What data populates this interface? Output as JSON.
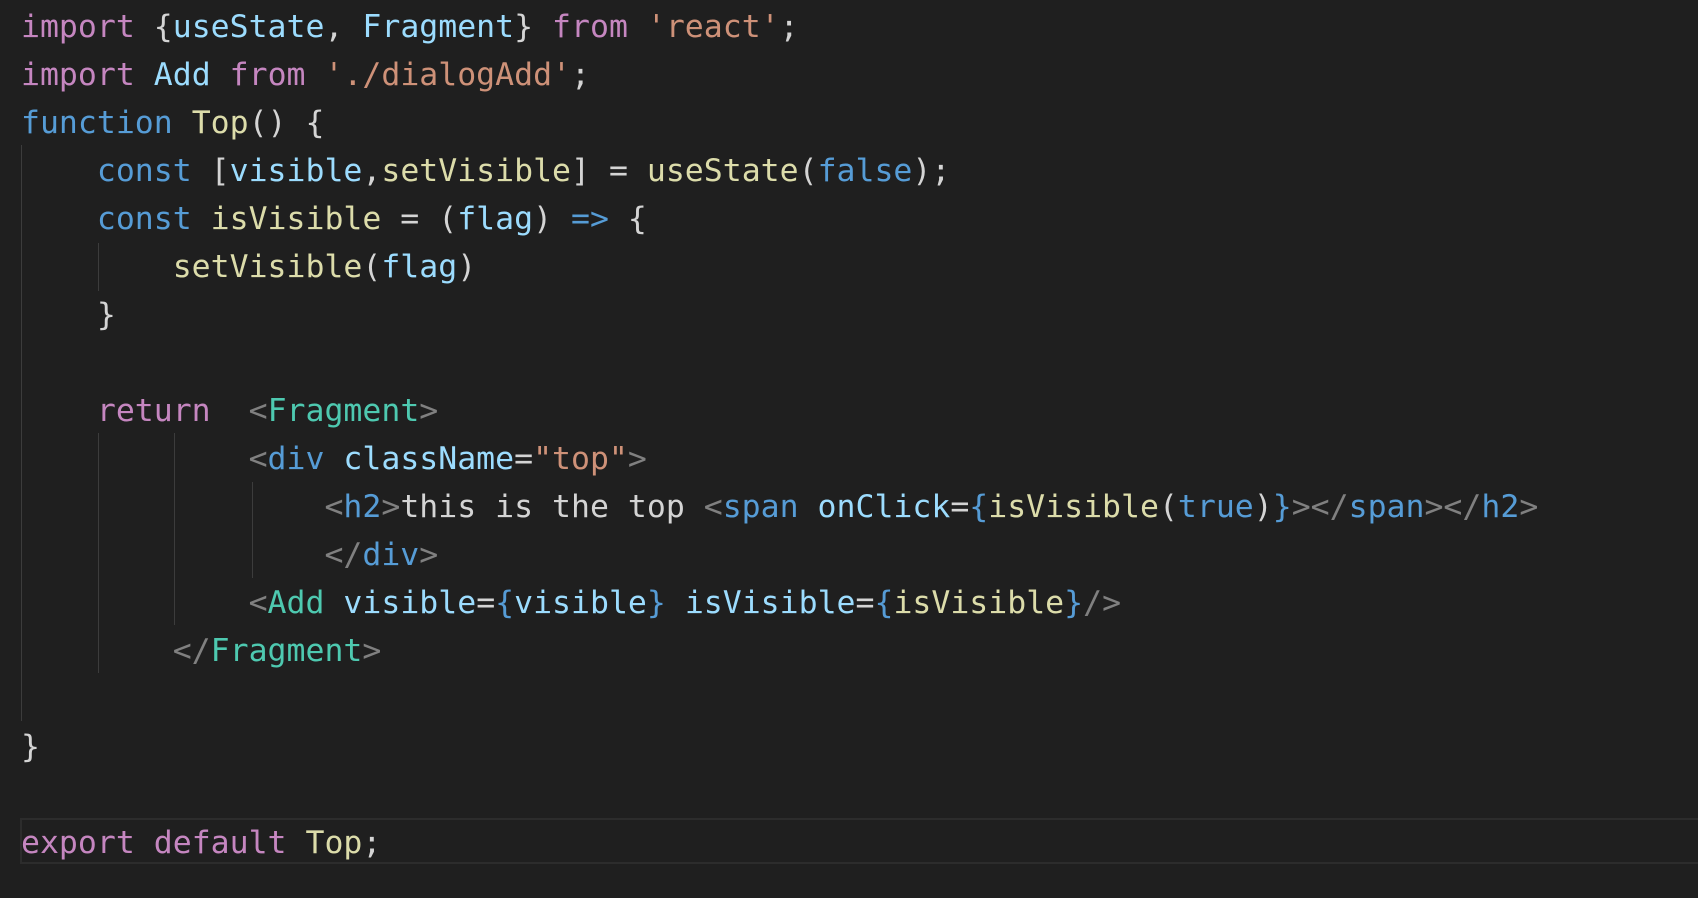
{
  "editor": {
    "language": "JavaScript (JSX)",
    "theme_background": "#1f1f1f",
    "colors": {
      "keyword": "#c586c0",
      "storage": "#569cd6",
      "string": "#ce9178",
      "function": "#dcdcaa",
      "variable": "#9cdcfe",
      "component": "#4ec9b0",
      "punctuation": "#d4d4d4",
      "tag_bracket": "#808080"
    },
    "lines": [
      {
        "tokens": [
          {
            "t": "import",
            "c": "kw"
          },
          {
            "t": " {",
            "c": "pn"
          },
          {
            "t": "useState",
            "c": "var"
          },
          {
            "t": ", ",
            "c": "pn"
          },
          {
            "t": "Fragment",
            "c": "var"
          },
          {
            "t": "} ",
            "c": "pn"
          },
          {
            "t": "from",
            "c": "kw"
          },
          {
            "t": " ",
            "c": "pn"
          },
          {
            "t": "'react'",
            "c": "st"
          },
          {
            "t": ";",
            "c": "pn"
          }
        ]
      },
      {
        "tokens": [
          {
            "t": "import",
            "c": "kw"
          },
          {
            "t": " ",
            "c": "pn"
          },
          {
            "t": "Add",
            "c": "var"
          },
          {
            "t": " ",
            "c": "pn"
          },
          {
            "t": "from",
            "c": "kw"
          },
          {
            "t": " ",
            "c": "pn"
          },
          {
            "t": "'./dialogAdd'",
            "c": "st"
          },
          {
            "t": ";",
            "c": "pn"
          }
        ]
      },
      {
        "tokens": [
          {
            "t": "function",
            "c": "sto"
          },
          {
            "t": " ",
            "c": "pn"
          },
          {
            "t": "Top",
            "c": "fn"
          },
          {
            "t": "() {",
            "c": "pn"
          }
        ]
      },
      {
        "tokens": [
          {
            "t": "    ",
            "c": "pn"
          },
          {
            "t": "const",
            "c": "sto"
          },
          {
            "t": " [",
            "c": "pn"
          },
          {
            "t": "visible",
            "c": "var"
          },
          {
            "t": ",",
            "c": "pn"
          },
          {
            "t": "setVisible",
            "c": "fn"
          },
          {
            "t": "] = ",
            "c": "pn"
          },
          {
            "t": "useState",
            "c": "fn"
          },
          {
            "t": "(",
            "c": "pn"
          },
          {
            "t": "false",
            "c": "sto"
          },
          {
            "t": ");",
            "c": "pn"
          }
        ]
      },
      {
        "tokens": [
          {
            "t": "    ",
            "c": "pn"
          },
          {
            "t": "const",
            "c": "sto"
          },
          {
            "t": " ",
            "c": "pn"
          },
          {
            "t": "isVisible",
            "c": "fn"
          },
          {
            "t": " = (",
            "c": "pn"
          },
          {
            "t": "flag",
            "c": "var"
          },
          {
            "t": ") ",
            "c": "pn"
          },
          {
            "t": "=>",
            "c": "sto"
          },
          {
            "t": " {",
            "c": "pn"
          }
        ]
      },
      {
        "tokens": [
          {
            "t": "        ",
            "c": "pn"
          },
          {
            "t": "setVisible",
            "c": "fn"
          },
          {
            "t": "(",
            "c": "pn"
          },
          {
            "t": "flag",
            "c": "var"
          },
          {
            "t": ")",
            "c": "pn"
          }
        ]
      },
      {
        "tokens": [
          {
            "t": "    }",
            "c": "pn"
          }
        ]
      },
      {
        "tokens": []
      },
      {
        "tokens": [
          {
            "t": "    ",
            "c": "pn"
          },
          {
            "t": "return",
            "c": "kw"
          },
          {
            "t": "  ",
            "c": "pn"
          },
          {
            "t": "<",
            "c": "tagb"
          },
          {
            "t": "Fragment",
            "c": "jsx"
          },
          {
            "t": ">",
            "c": "tagb"
          }
        ]
      },
      {
        "tokens": [
          {
            "t": "            ",
            "c": "pn"
          },
          {
            "t": "<",
            "c": "tagb"
          },
          {
            "t": "div",
            "c": "sto"
          },
          {
            "t": " ",
            "c": "pn"
          },
          {
            "t": "className",
            "c": "var"
          },
          {
            "t": "=",
            "c": "pn"
          },
          {
            "t": "\"top\"",
            "c": "st"
          },
          {
            "t": ">",
            "c": "tagb"
          }
        ]
      },
      {
        "tokens": [
          {
            "t": "                ",
            "c": "pn"
          },
          {
            "t": "<",
            "c": "tagb"
          },
          {
            "t": "h2",
            "c": "sto"
          },
          {
            "t": ">",
            "c": "tagb"
          },
          {
            "t": "this is the top ",
            "c": "txt"
          },
          {
            "t": "<",
            "c": "tagb"
          },
          {
            "t": "span",
            "c": "sto"
          },
          {
            "t": " ",
            "c": "pn"
          },
          {
            "t": "onClick",
            "c": "var"
          },
          {
            "t": "=",
            "c": "pn"
          },
          {
            "t": "{",
            "c": "sto"
          },
          {
            "t": "isVisible",
            "c": "fn"
          },
          {
            "t": "(",
            "c": "pn"
          },
          {
            "t": "true",
            "c": "sto"
          },
          {
            "t": ")",
            "c": "pn"
          },
          {
            "t": "}",
            "c": "sto"
          },
          {
            "t": "></",
            "c": "tagb"
          },
          {
            "t": "span",
            "c": "sto"
          },
          {
            "t": "></",
            "c": "tagb"
          },
          {
            "t": "h2",
            "c": "sto"
          },
          {
            "t": ">",
            "c": "tagb"
          }
        ]
      },
      {
        "tokens": [
          {
            "t": "                ",
            "c": "pn"
          },
          {
            "t": "</",
            "c": "tagb"
          },
          {
            "t": "div",
            "c": "sto"
          },
          {
            "t": ">",
            "c": "tagb"
          }
        ]
      },
      {
        "tokens": [
          {
            "t": "            ",
            "c": "pn"
          },
          {
            "t": "<",
            "c": "tagb"
          },
          {
            "t": "Add",
            "c": "jsx"
          },
          {
            "t": " ",
            "c": "pn"
          },
          {
            "t": "visible",
            "c": "var"
          },
          {
            "t": "=",
            "c": "pn"
          },
          {
            "t": "{",
            "c": "sto"
          },
          {
            "t": "visible",
            "c": "var"
          },
          {
            "t": "}",
            "c": "sto"
          },
          {
            "t": " ",
            "c": "pn"
          },
          {
            "t": "isVisible",
            "c": "var"
          },
          {
            "t": "=",
            "c": "pn"
          },
          {
            "t": "{",
            "c": "sto"
          },
          {
            "t": "isVisible",
            "c": "fn"
          },
          {
            "t": "}",
            "c": "sto"
          },
          {
            "t": "/>",
            "c": "tagb"
          }
        ]
      },
      {
        "tokens": [
          {
            "t": "        ",
            "c": "pn"
          },
          {
            "t": "</",
            "c": "tagb"
          },
          {
            "t": "Fragment",
            "c": "jsx"
          },
          {
            "t": ">",
            "c": "tagb"
          }
        ]
      },
      {
        "tokens": []
      },
      {
        "tokens": [
          {
            "t": "}",
            "c": "pn"
          }
        ]
      },
      {
        "tokens": []
      },
      {
        "tokens": [
          {
            "t": "export",
            "c": "kw"
          },
          {
            "t": " ",
            "c": "pn"
          },
          {
            "t": "default",
            "c": "kw"
          },
          {
            "t": " ",
            "c": "pn"
          },
          {
            "t": "Top",
            "c": "fn"
          },
          {
            "t": ";",
            "c": "pn"
          }
        ]
      }
    ]
  }
}
